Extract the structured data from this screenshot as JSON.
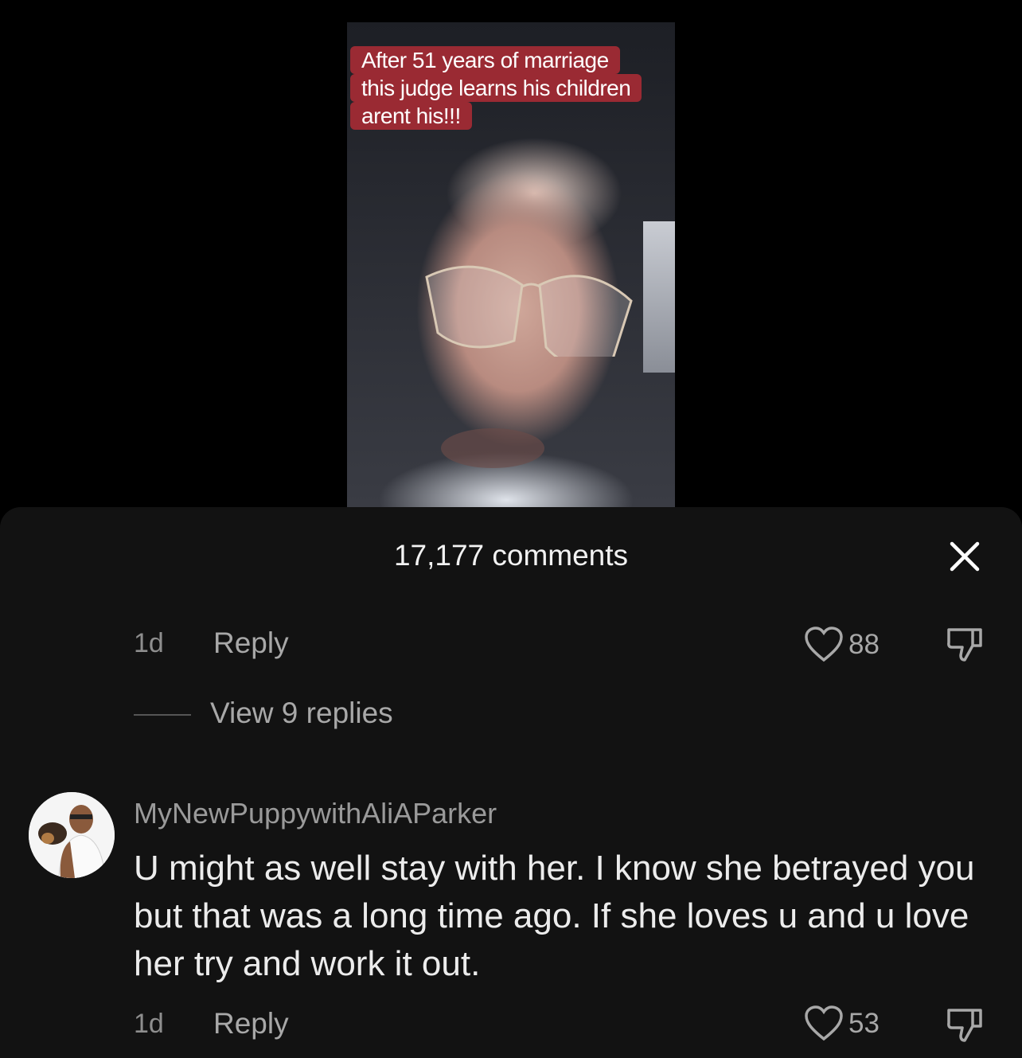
{
  "video": {
    "caption_lines": [
      "After 51 years of marriage",
      "this judge learns his children",
      "arent his!!!"
    ]
  },
  "comments_sheet": {
    "title": "17,177 comments",
    "close_icon": "close-icon",
    "first_comment_footer": {
      "time": "1d",
      "reply_label": "Reply",
      "like_count": "88",
      "like_icon": "heart-outline-icon",
      "dislike_icon": "thumbs-down-icon"
    },
    "view_replies_label": "View 9 replies",
    "second_comment": {
      "username": "MyNewPuppywithAliAParker",
      "text": "U might as well stay with her. I know she betrayed you but that was a long time ago. If she loves u and u love her try and work it out.",
      "time": "1d",
      "reply_label": "Reply",
      "like_count": "53",
      "like_icon": "heart-outline-icon",
      "dislike_icon": "thumbs-down-icon"
    }
  }
}
